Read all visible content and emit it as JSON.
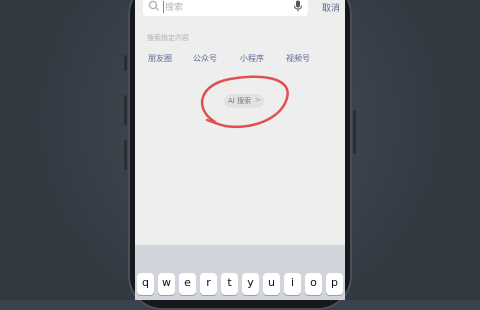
{
  "search": {
    "placeholder": "搜索",
    "cancel_label": "取消"
  },
  "hint": "搜索指定内容",
  "categories": [
    "朋友圈",
    "公众号",
    "小程序",
    "视频号"
  ],
  "ai_search": {
    "label": "AI 搜索",
    "chevron": ">"
  },
  "annotation": {
    "color": "#e05050"
  },
  "keyboard": {
    "row1": [
      "q",
      "w",
      "e",
      "r",
      "t",
      "y",
      "u",
      "i",
      "o",
      "p"
    ]
  }
}
